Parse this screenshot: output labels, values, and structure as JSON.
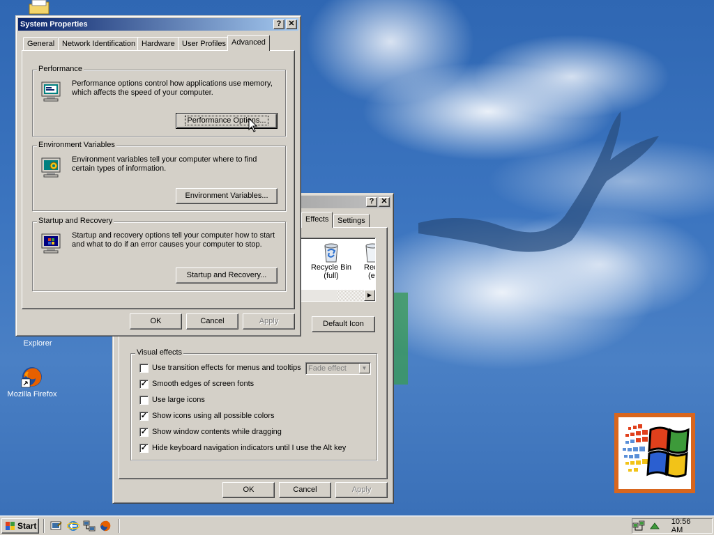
{
  "desktop": {
    "icons": [
      {
        "label": "Internet Explorer",
        "icon": "internet-explorer-icon"
      },
      {
        "label": "Mozilla Firefox",
        "icon": "firefox-icon"
      }
    ]
  },
  "display_props": {
    "tabs": [
      {
        "label": "Effects"
      },
      {
        "label": "Settings"
      }
    ],
    "icons": [
      {
        "label": "Recycle Bin (full)",
        "line1": "Recycle Bin",
        "line2": "(full)"
      },
      {
        "line1": "Rec",
        "line2": "(e"
      }
    ],
    "default_icon_label": "Default Icon",
    "visual_effects": {
      "title": "Visual effects",
      "options": [
        {
          "label": "Use transition effects for menus and tooltips",
          "checked": false
        },
        {
          "label": "Smooth edges of screen fonts",
          "checked": true
        },
        {
          "label": "Use large icons",
          "checked": false
        },
        {
          "label": "Show icons using all possible colors",
          "checked": true
        },
        {
          "label": "Show window contents while dragging",
          "checked": true
        },
        {
          "label": "Hide keyboard navigation indicators until I use the Alt key",
          "checked": true
        }
      ],
      "transition_value": "Fade effect"
    },
    "buttons": {
      "ok": "OK",
      "cancel": "Cancel",
      "apply": "Apply"
    },
    "help": "?",
    "close": "✕"
  },
  "system_props": {
    "title": "System Properties",
    "help": "?",
    "close": "✕",
    "tabs": [
      {
        "label": "General"
      },
      {
        "label": "Network Identification"
      },
      {
        "label": "Hardware"
      },
      {
        "label": "User Profiles"
      },
      {
        "label": "Advanced"
      }
    ],
    "active_tab": "Advanced",
    "performance": {
      "title": "Performance",
      "description": "Performance options control how applications use memory, which affects the speed of your computer.",
      "button": "Performance Options..."
    },
    "environment": {
      "title": "Environment Variables",
      "description": "Environment variables tell your computer where to find certain types of information.",
      "button": "Environment Variables..."
    },
    "startup": {
      "title": "Startup and Recovery",
      "description": "Startup and recovery options tell your computer how to start and what to do if an error causes your computer to stop.",
      "button": "Startup and Recovery..."
    },
    "buttons": {
      "ok": "OK",
      "cancel": "Cancel",
      "apply": "Apply"
    }
  },
  "taskbar": {
    "start_label": "Start",
    "clock": "10:56 AM",
    "quick_launch": [
      "show-desktop-icon",
      "internet-explorer-icon",
      "network-icon",
      "firefox-icon"
    ]
  },
  "colors": {
    "titlebar_active": "#0a246a",
    "face": "#d4d0c8",
    "desktop": "#3a6ea5"
  }
}
